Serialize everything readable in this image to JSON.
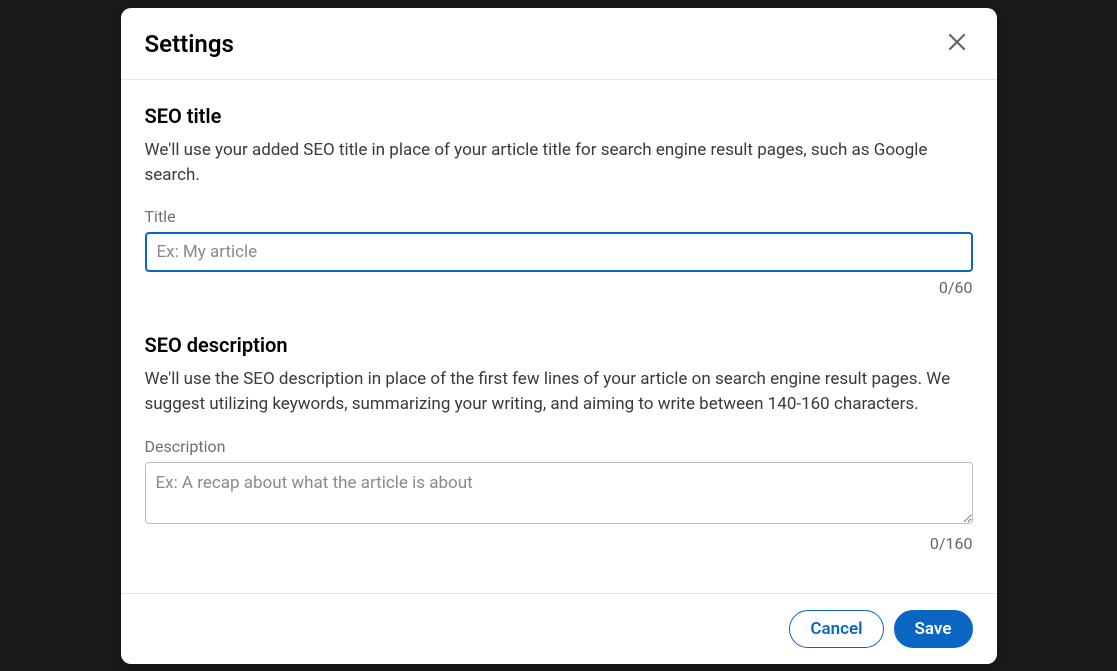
{
  "modal": {
    "title": "Settings"
  },
  "seo_title": {
    "heading": "SEO title",
    "explain": "We'll use your added SEO title in place of your article title for search engine result pages, such as Google search.",
    "label": "Title",
    "placeholder": "Ex: My article",
    "value": "",
    "counter": "0/60"
  },
  "seo_description": {
    "heading": "SEO description",
    "explain": "We'll use the SEO description in place of the first few lines of your article on search engine result pages. We suggest utilizing keywords, summarizing your writing, and aiming to write between 140-160 characters.",
    "label": "Description",
    "placeholder": "Ex: A recap about what the article is about",
    "value": "",
    "counter": "0/160"
  },
  "actions": {
    "cancel": "Cancel",
    "save": "Save"
  }
}
